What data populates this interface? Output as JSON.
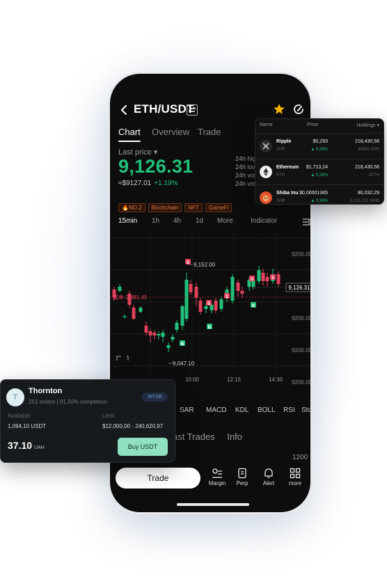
{
  "header": {
    "pair": "ETH/USDT"
  },
  "tabs": [
    "Chart",
    "Overview",
    "Trade"
  ],
  "price": {
    "last_label": "Last price",
    "value": "9,126.31",
    "fiat": "≈$9127.01",
    "change": "+1.19%",
    "stats": [
      "24h high",
      "24h low",
      "24h vol(",
      "24h vol("
    ]
  },
  "tags": [
    "🔥NO.2",
    "Blockchain",
    "NFT",
    "GameFi"
  ],
  "intervals": [
    "15min",
    "1h",
    "4h",
    "1d",
    "More",
    "Indicator"
  ],
  "chart_data": {
    "type": "candlestick",
    "y_labels": [
      "9200.00",
      "9200.00",
      "9200.00",
      "9200.00",
      "9200.00"
    ],
    "x_labels": [
      "10:00",
      "12:15",
      "14:30"
    ],
    "high_label": "9,152.00",
    "low_label": "9,047.10",
    "last_label": "9,126.31",
    "cost_label": "成本 2,481.45",
    "colors": {
      "up": "#22c07a",
      "down": "#e0415b"
    }
  },
  "indicators": [
    "SAR",
    "MACD",
    "KDL",
    "BOLL",
    "RSI",
    "Sto"
  ],
  "lower": {
    "tab1": "ast Trades",
    "tab2": "Info",
    "value": "1200"
  },
  "nav": {
    "trade": "Trade",
    "items": [
      "Margin",
      "Perp",
      "Alert",
      "more"
    ]
  },
  "holdings": {
    "headers": {
      "name": "Name",
      "price": "Price",
      "holdings": "Holdings"
    },
    "rows": [
      {
        "name": "Ripple",
        "sym": "XPR",
        "price": "$0,293",
        "change": "0,26%",
        "hold": "218,430,56",
        "hold_sub": "45092 XPR"
      },
      {
        "name": "Ethereum",
        "sym": "ETH",
        "price": "$1,713,24",
        "change": "0,26%",
        "hold": "218,430,56",
        "hold_sub": "2ETH"
      },
      {
        "name": "Shiba Inu",
        "sym": "SHB",
        "price": "$0,00001365",
        "change": "3,36%",
        "hold": "80,032,29",
        "hold_sub": "2,222,222 SHIB"
      }
    ]
  },
  "p2p": {
    "avatar": "T",
    "name": "Thornton",
    "orders": "251 orders | 91,30% completion",
    "badge": "WYSE",
    "available_label": "Available",
    "available_value": "1,094,10 USDT",
    "limit_label": "Limit",
    "limit_value": "$12,000,00 - 240,620,97",
    "amount": "37.10",
    "currency": "UAH",
    "buy": "Buy USDT"
  }
}
